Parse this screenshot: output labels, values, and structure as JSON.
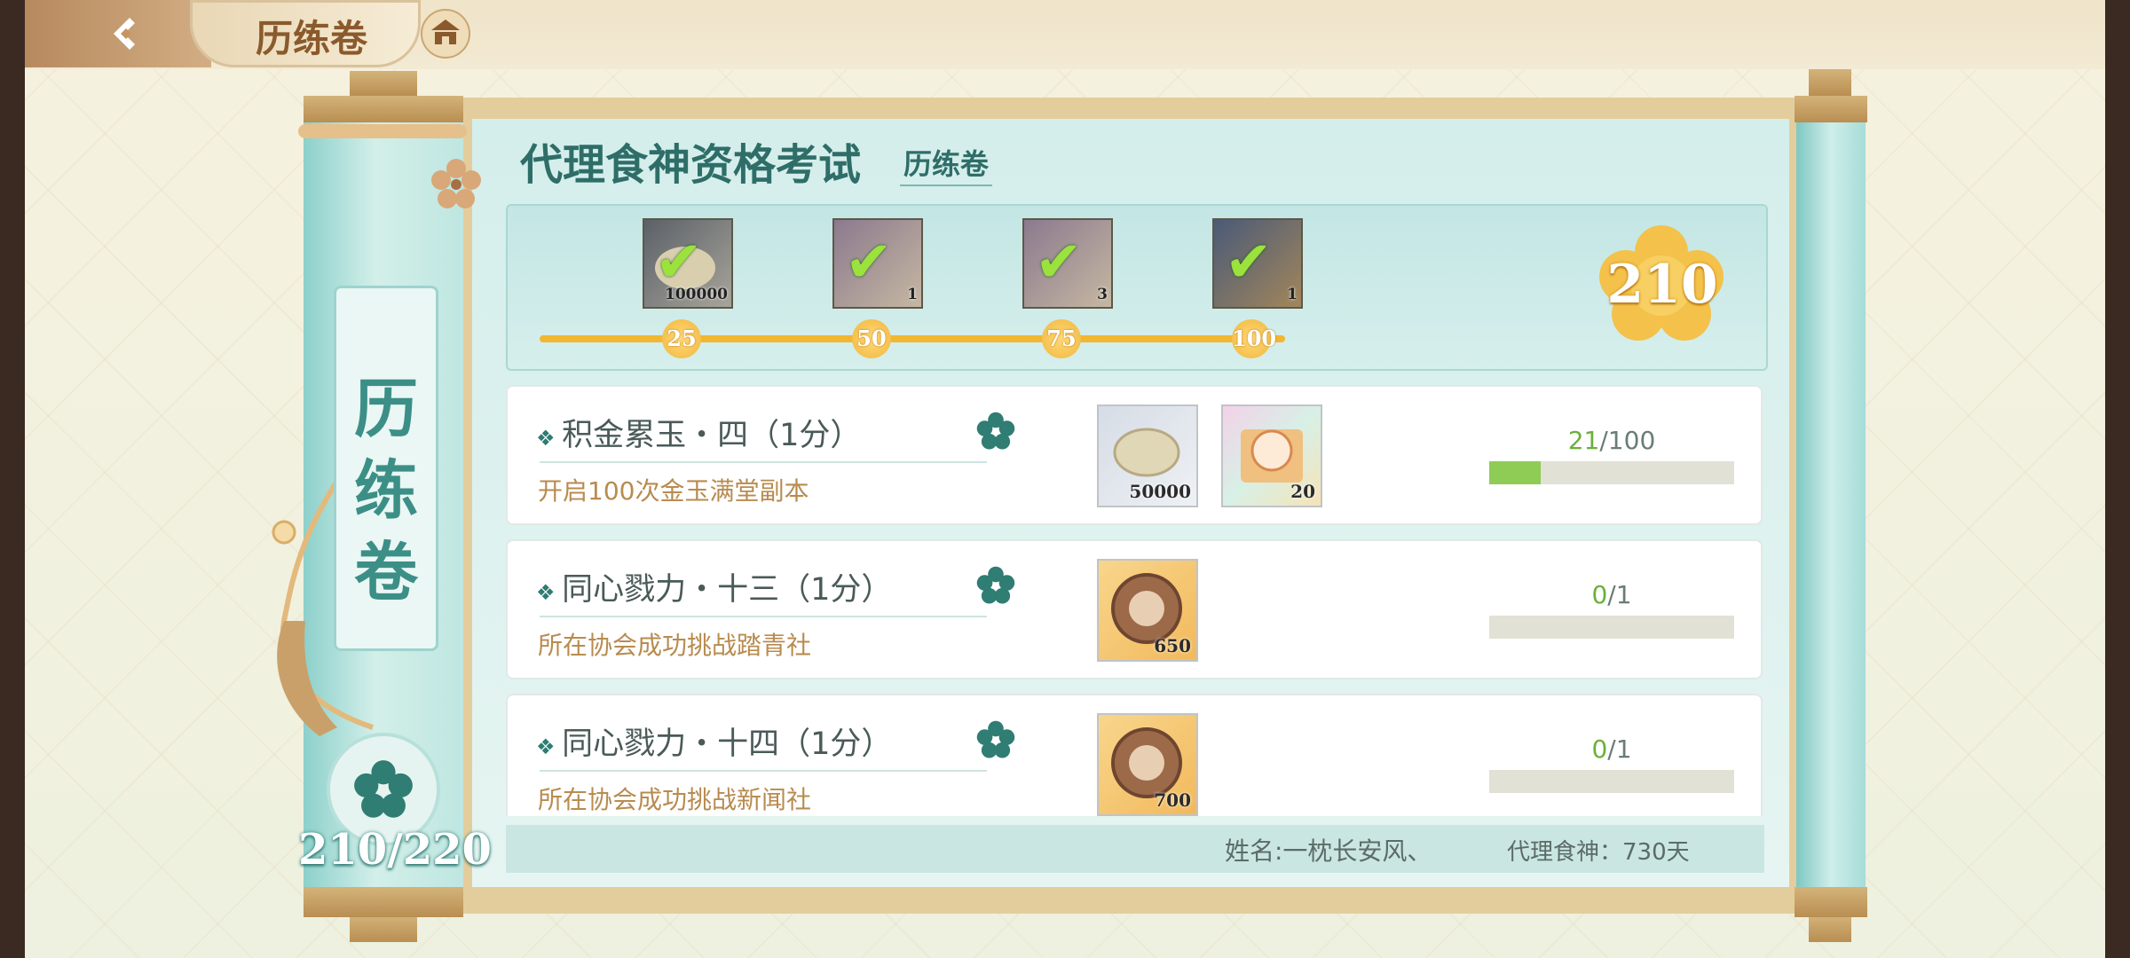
{
  "header": {
    "back_label": "",
    "title": "历练卷",
    "home_icon": "pavilion-icon"
  },
  "scroll": {
    "side_title": "历练卷",
    "total_progress": "210/220"
  },
  "exam": {
    "title": "代理食神资格考试",
    "subtitle": "历练卷",
    "score": "210",
    "milestones": [
      {
        "threshold": "25",
        "qty": "100000",
        "claimed": true
      },
      {
        "threshold": "50",
        "qty": "1",
        "claimed": true
      },
      {
        "threshold": "75",
        "qty": "3",
        "claimed": true
      },
      {
        "threshold": "100",
        "qty": "1",
        "claimed": true
      }
    ]
  },
  "tasks": [
    {
      "name": "积金累玉・四（1分）",
      "desc": "开启100次金玉满堂副本",
      "current": "21",
      "total": "/100",
      "progress": 0.21,
      "rewards": [
        {
          "qty": "50000",
          "icon": "shell-coin-icon"
        },
        {
          "qty": "20",
          "icon": "character-card-icon"
        }
      ]
    },
    {
      "name": "同心戮力・十三（1分）",
      "desc": "所在协会成功挑战踏青社",
      "current": "0",
      "total": "/1",
      "progress": 0,
      "rewards": [
        {
          "qty": "650",
          "icon": "bronze-medal-icon"
        }
      ]
    },
    {
      "name": "同心戮力・十四（1分）",
      "desc": "所在协会成功挑战新闻社",
      "current": "0",
      "total": "/1",
      "progress": 0,
      "rewards": [
        {
          "qty": "700",
          "icon": "bronze-medal-icon"
        }
      ]
    }
  ],
  "footer": {
    "name": "姓名:一枕长安风、",
    "days": "代理食神：730天"
  },
  "colors": {
    "accent": "#2f6e68",
    "gold": "#f1b731",
    "progress_green": "#8fcc55"
  }
}
